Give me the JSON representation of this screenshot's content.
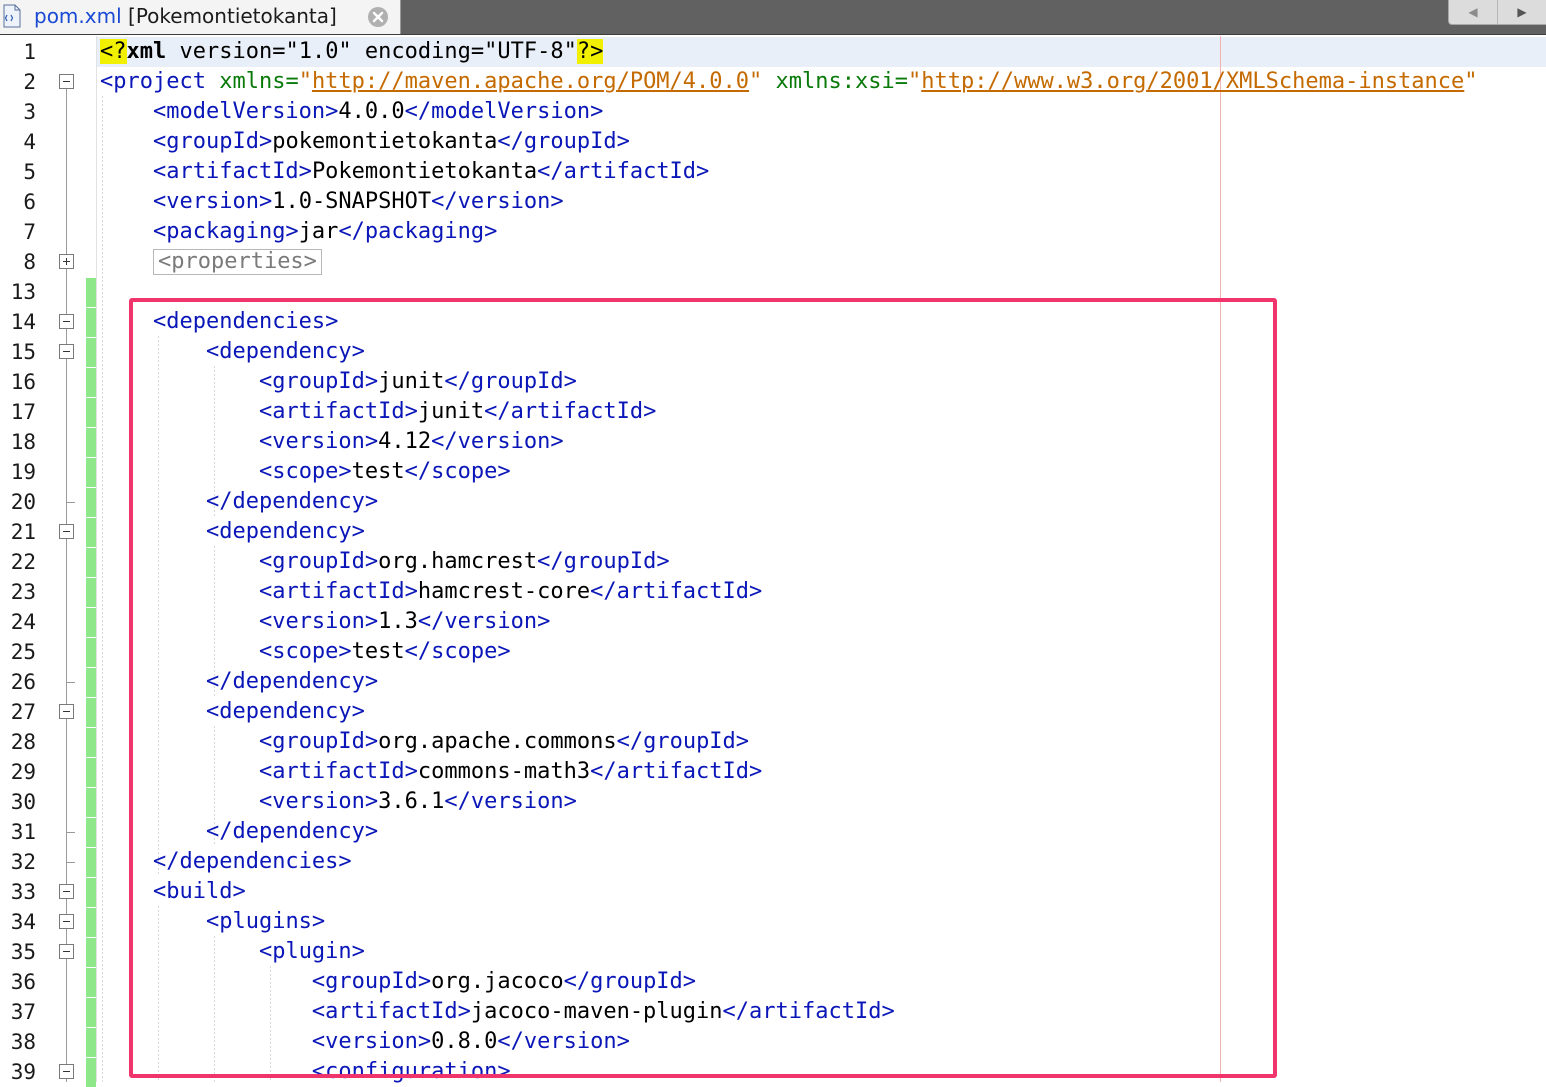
{
  "tab": {
    "filename": "pom.xml",
    "project": "[Pokemontietokanta]",
    "icon": "xml-file-icon",
    "close_icon": "close-circle-icon"
  },
  "nav": {
    "left_arrow": "◀",
    "right_arrow": "▶"
  },
  "colors": {
    "tag": "#0a16b8",
    "attribute_name": "#0a7a0a",
    "attribute_value": "#c46a00",
    "change_marker": "#8ee88a",
    "annotation_box": "#f0356d"
  },
  "editor": {
    "lines": [
      {
        "n": "1",
        "fold": "none"
      },
      {
        "n": "2",
        "fold": "open"
      },
      {
        "n": "3",
        "fold": "none"
      },
      {
        "n": "4",
        "fold": "none"
      },
      {
        "n": "5",
        "fold": "none"
      },
      {
        "n": "6",
        "fold": "none"
      },
      {
        "n": "7",
        "fold": "none"
      },
      {
        "n": "8",
        "fold": "closed"
      },
      {
        "n": "13",
        "fold": "none",
        "changed": true
      },
      {
        "n": "14",
        "fold": "open",
        "changed": true
      },
      {
        "n": "15",
        "fold": "open",
        "changed": true
      },
      {
        "n": "16",
        "fold": "none",
        "changed": true
      },
      {
        "n": "17",
        "fold": "none",
        "changed": true
      },
      {
        "n": "18",
        "fold": "none",
        "changed": true
      },
      {
        "n": "19",
        "fold": "none",
        "changed": true
      },
      {
        "n": "20",
        "fold": "end",
        "changed": true
      },
      {
        "n": "21",
        "fold": "open",
        "changed": true
      },
      {
        "n": "22",
        "fold": "none",
        "changed": true
      },
      {
        "n": "23",
        "fold": "none",
        "changed": true
      },
      {
        "n": "24",
        "fold": "none",
        "changed": true
      },
      {
        "n": "25",
        "fold": "none",
        "changed": true
      },
      {
        "n": "26",
        "fold": "end",
        "changed": true
      },
      {
        "n": "27",
        "fold": "open",
        "changed": true
      },
      {
        "n": "28",
        "fold": "none",
        "changed": true
      },
      {
        "n": "29",
        "fold": "none",
        "changed": true
      },
      {
        "n": "30",
        "fold": "none",
        "changed": true
      },
      {
        "n": "31",
        "fold": "end",
        "changed": true
      },
      {
        "n": "32",
        "fold": "end",
        "changed": true
      },
      {
        "n": "33",
        "fold": "open",
        "changed": true
      },
      {
        "n": "34",
        "fold": "open",
        "changed": true
      },
      {
        "n": "35",
        "fold": "open",
        "changed": true
      },
      {
        "n": "36",
        "fold": "none",
        "changed": true
      },
      {
        "n": "37",
        "fold": "none",
        "changed": true
      },
      {
        "n": "38",
        "fold": "none",
        "changed": true
      },
      {
        "n": "39",
        "fold": "open",
        "changed": true
      }
    ],
    "code": {
      "l1": {
        "pi_open": "<?",
        "pi_name": "xml",
        "attrs": " version=\"1.0\" encoding=\"UTF-8\"",
        "pi_close": "?>"
      },
      "l2": {
        "open": "<project",
        "a1_name": " xmlns=",
        "a1_q": "\"",
        "a1_val": "http://maven.apache.org/POM/4.0.0",
        "a1_q2": "\"",
        "a2_name": " xmlns:xsi=",
        "a2_q": "\"",
        "a2_val": "http://www.w3.org/2001/XMLSchema-instance",
        "a2_q2": "\""
      },
      "l3": {
        "open": "<modelVersion>",
        "text": "4.0.0",
        "close": "</modelVersion>"
      },
      "l4": {
        "open": "<groupId>",
        "text": "pokemontietokanta",
        "close": "</groupId>"
      },
      "l5": {
        "open": "<artifactId>",
        "text": "Pokemontietokanta",
        "close": "</artifactId>"
      },
      "l6": {
        "open": "<version>",
        "text": "1.0-SNAPSHOT",
        "close": "</version>"
      },
      "l7": {
        "open": "<packaging>",
        "text": "jar",
        "close": "</packaging>"
      },
      "l8": {
        "folded": "<properties>"
      },
      "l13": {},
      "l14": {
        "open": "<dependencies>"
      },
      "l15": {
        "open": "<dependency>"
      },
      "l16": {
        "open": "<groupId>",
        "text": "junit",
        "close": "</groupId>"
      },
      "l17": {
        "open": "<artifactId>",
        "text": "junit",
        "close": "</artifactId>"
      },
      "l18": {
        "open": "<version>",
        "text": "4.12",
        "close": "</version>"
      },
      "l19": {
        "open": "<scope>",
        "text": "test",
        "close": "</scope>"
      },
      "l20": {
        "close": "</dependency>"
      },
      "l21": {
        "open": "<dependency>"
      },
      "l22": {
        "open": "<groupId>",
        "text": "org.hamcrest",
        "close": "</groupId>"
      },
      "l23": {
        "open": "<artifactId>",
        "text": "hamcrest-core",
        "close": "</artifactId>"
      },
      "l24": {
        "open": "<version>",
        "text": "1.3",
        "close": "</version>"
      },
      "l25": {
        "open": "<scope>",
        "text": "test",
        "close": "</scope>"
      },
      "l26": {
        "close": "</dependency>"
      },
      "l27": {
        "open": "<dependency>"
      },
      "l28": {
        "open": "<groupId>",
        "text": "org.apache.commons",
        "close": "</groupId>"
      },
      "l29": {
        "open": "<artifactId>",
        "text": "commons-math3",
        "close": "</artifactId>"
      },
      "l30": {
        "open": "<version>",
        "text": "3.6.1",
        "close": "</version>"
      },
      "l31": {
        "close": "</dependency>"
      },
      "l32": {
        "close": "</dependencies>"
      },
      "l33": {
        "open": "<build>"
      },
      "l34": {
        "open": "<plugins>"
      },
      "l35": {
        "open": "<plugin>"
      },
      "l36": {
        "open": "<groupId>",
        "text": "org.jacoco",
        "close": "</groupId>"
      },
      "l37": {
        "open": "<artifactId>",
        "text": "jacoco-maven-plugin",
        "close": "</artifactId>"
      },
      "l38": {
        "open": "<version>",
        "text": "0.8.0",
        "close": "</version>"
      },
      "l39": {
        "open": "<configuration>"
      }
    }
  }
}
